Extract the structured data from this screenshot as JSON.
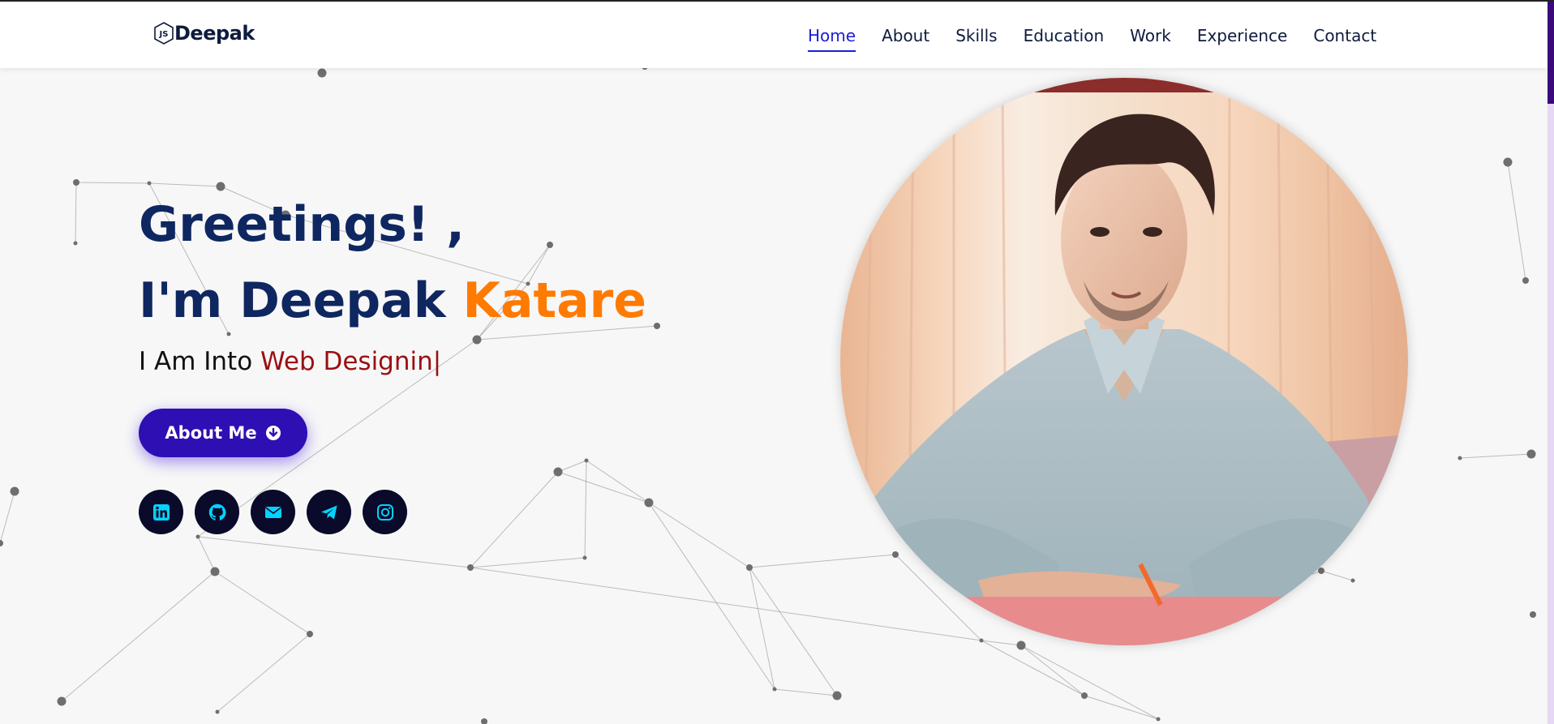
{
  "header": {
    "logo_text": "Deepak",
    "logo_icon": "js-hexagon-icon",
    "nav": [
      {
        "label": "Home",
        "active": true
      },
      {
        "label": "About",
        "active": false
      },
      {
        "label": "Skills",
        "active": false
      },
      {
        "label": "Education",
        "active": false
      },
      {
        "label": "Work",
        "active": false
      },
      {
        "label": "Experience",
        "active": false
      },
      {
        "label": "Contact",
        "active": false
      }
    ]
  },
  "hero": {
    "greeting": "Greetings! ,",
    "name_prefix": "I'm Deepak ",
    "name_accent": "Katare",
    "role_prefix": "I Am Into ",
    "role_accent": "Web Designin|",
    "about_button": "About Me",
    "about_button_icon": "arrow-down-circle-icon"
  },
  "socials": [
    {
      "name": "linkedin",
      "icon": "linkedin-icon"
    },
    {
      "name": "github",
      "icon": "github-icon"
    },
    {
      "name": "email",
      "icon": "envelope-icon"
    },
    {
      "name": "telegram",
      "icon": "telegram-icon"
    },
    {
      "name": "instagram",
      "icon": "instagram-icon"
    }
  ],
  "colors": {
    "nav_active": "#1b1dd8",
    "heading": "#0f2760",
    "name_accent": "#ff7a00",
    "role_accent": "#9a0f12",
    "button_bg": "#2e0fb3",
    "social_bg": "#0a0a2a",
    "social_icon": "#00d4ff",
    "scrollbar_thumb": "#3a0a7a",
    "scrollbar_track": "#e6d7f5"
  }
}
